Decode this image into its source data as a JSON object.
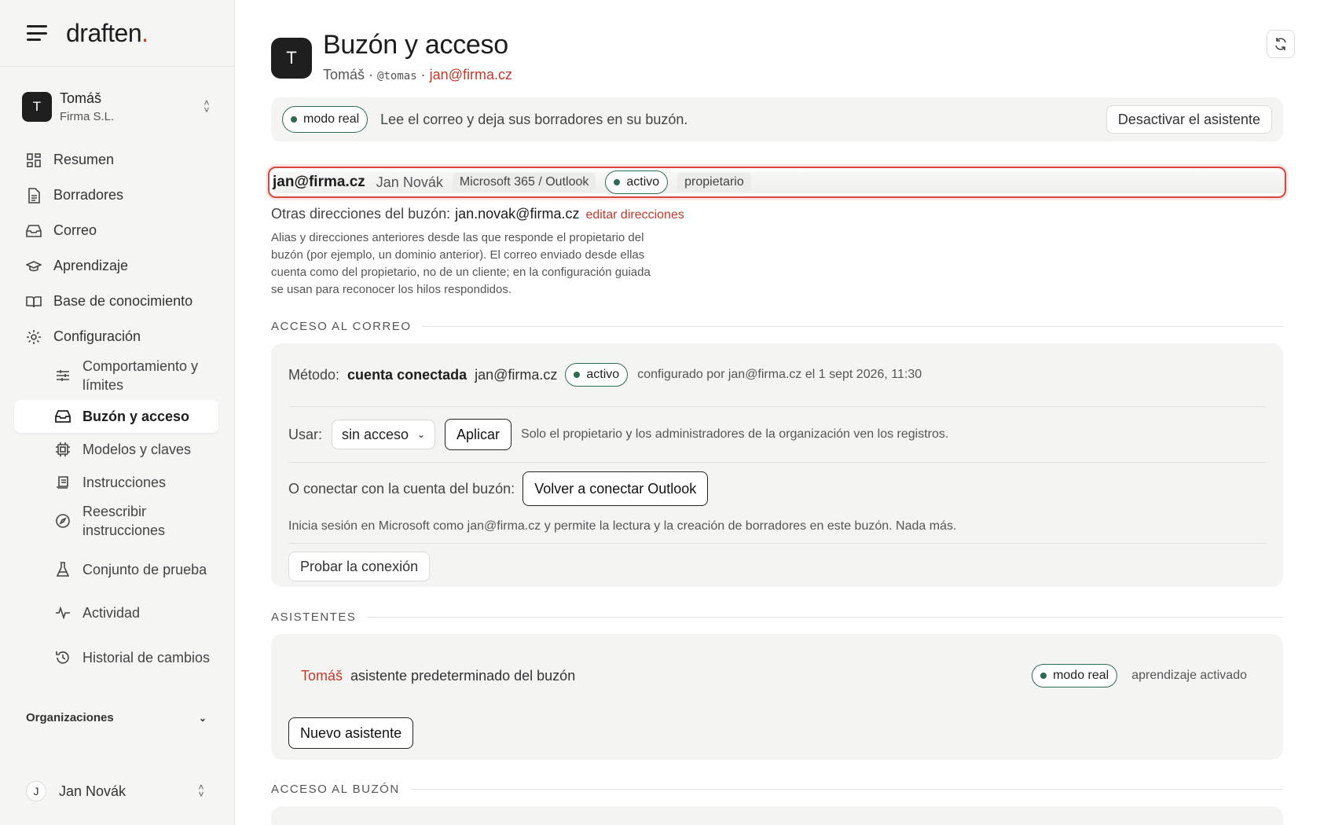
{
  "brand": {
    "name": "draften",
    "dot": "."
  },
  "account": {
    "initial": "T",
    "name": "Tomáš",
    "org": "Firma S.L."
  },
  "nav": {
    "items": [
      {
        "label": "Resumen",
        "icon": "dashboard-icon"
      },
      {
        "label": "Borradores",
        "icon": "document-icon"
      },
      {
        "label": "Correo",
        "icon": "inbox-icon"
      },
      {
        "label": "Aprendizaje",
        "icon": "graduation-icon"
      },
      {
        "label": "Base de conocimiento",
        "icon": "book-icon"
      },
      {
        "label": "Configuración",
        "icon": "gear-icon"
      }
    ],
    "sub": [
      {
        "label": "Comportamiento y límites",
        "icon": "sliders-icon"
      },
      {
        "label": "Buzón y acceso",
        "icon": "inbox-icon",
        "active": true
      },
      {
        "label": "Modelos y claves",
        "icon": "chip-icon"
      },
      {
        "label": "Instrucciones",
        "icon": "scroll-icon"
      },
      {
        "label": "Reescribir instrucciones",
        "icon": "compass-icon"
      },
      {
        "label": "Conjunto de prueba",
        "icon": "flask-icon"
      },
      {
        "label": "Actividad",
        "icon": "activity-icon"
      },
      {
        "label": "Historial de cambios",
        "icon": "history-icon"
      }
    ],
    "orgs_label": "Organizaciones"
  },
  "user": {
    "initial": "J",
    "name": "Jan Novák"
  },
  "header": {
    "initial": "T",
    "title": "Buzón y acceso",
    "owner": "Tomáš",
    "sep": "·",
    "handle": "@tomas",
    "email": "jan@firma.cz"
  },
  "banner": {
    "mode": "modo real",
    "text": "Lee el correo y deja sus borradores en su buzón.",
    "deactivate": "Desactivar el asistente"
  },
  "mailbox": {
    "email": "jan@firma.cz",
    "name": "Jan Novák",
    "provider": "Microsoft 365 / Outlook",
    "status": "activo",
    "role": "propietario",
    "other_label": "Otras direcciones del buzón:",
    "other_value": "jan.novak@firma.cz",
    "edit_link": "editar direcciones",
    "help": "Alias y direcciones anteriores desde las que responde el propietario del buzón (por ejemplo, un dominio anterior). El correo enviado desde ellas cuenta como del propietario, no de un cliente; en la configuración guiada se usan para reconocer los hilos respondidos."
  },
  "mail_access": {
    "heading": "ACCESO AL CORREO",
    "method_label": "Método:",
    "method_value": "cuenta conectada",
    "method_email": "jan@firma.cz",
    "status": "activo",
    "configured": "configurado por jan@firma.cz el 1 sept 2026, 11:30",
    "use_label": "Usar:",
    "use_value": "sin acceso",
    "apply": "Aplicar",
    "use_note": "Solo el propietario y los administradores de la organización ven los registros.",
    "connect_label": "O conectar con la cuenta del buzón:",
    "reconnect": "Volver a conectar Outlook",
    "connect_note": "Inicia sesión en Microsoft como jan@firma.cz y permite la lectura y la creación de borradores en este buzón. Nada más.",
    "test": "Probar la conexión"
  },
  "assistants": {
    "heading": "ASISTENTES",
    "name": "Tomáš",
    "desc": "asistente predeterminado del buzón",
    "mode": "modo real",
    "learning": "aprendizaje activado",
    "new_btn": "Nuevo asistente"
  },
  "mailbox_access": {
    "heading": "ACCESO AL BUZÓN"
  },
  "colors": {
    "accent": "#c0392b",
    "active_green": "#2e6b4f",
    "highlight": "#d9443b"
  }
}
